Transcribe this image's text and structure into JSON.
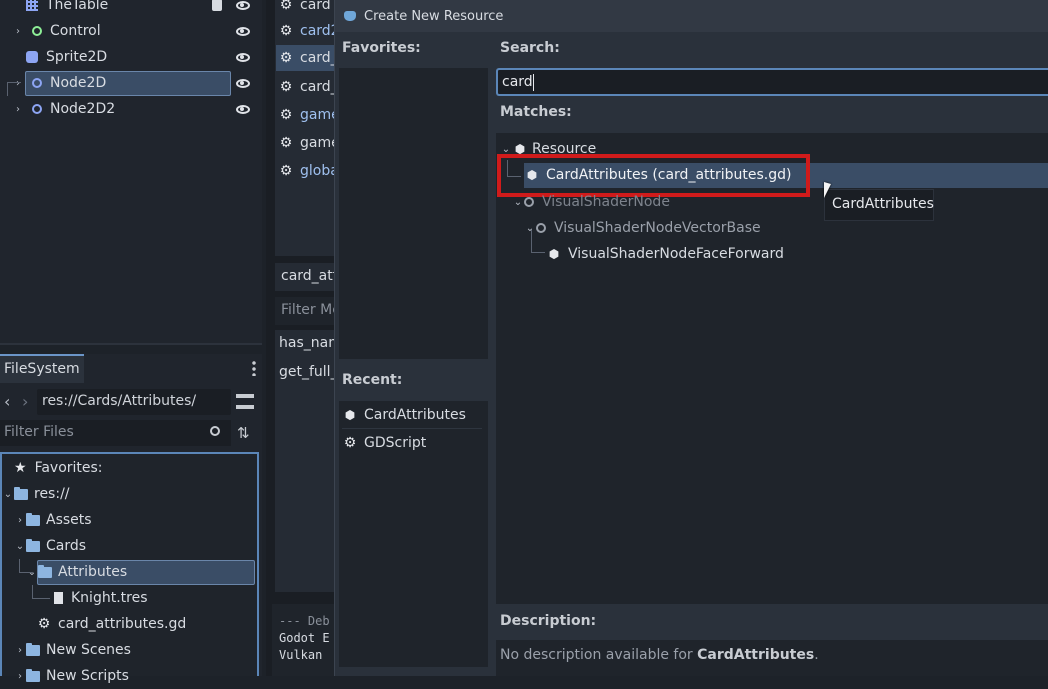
{
  "scene_tree": {
    "items": [
      {
        "label": "TheTable"
      },
      {
        "label": "Control"
      },
      {
        "label": "Sprite2D"
      },
      {
        "label": "Node2D"
      },
      {
        "label": "Node2D2"
      }
    ]
  },
  "filesystem": {
    "tab_label": "FileSystem",
    "path": "res://Cards/Attributes/",
    "filter_placeholder": "Filter Files",
    "favorites_label": "Favorites:",
    "items": [
      {
        "label": "res://"
      },
      {
        "label": "Assets"
      },
      {
        "label": "Cards"
      },
      {
        "label": "Attributes"
      },
      {
        "label": "Knight.tres"
      },
      {
        "label": "card_attributes.gd"
      },
      {
        "label": "New Scenes"
      },
      {
        "label": "New Scripts"
      }
    ]
  },
  "script_list": {
    "items": [
      "card",
      "card2",
      "card_",
      "card_",
      "game",
      "game",
      "globa"
    ],
    "current_file": "card_att",
    "filter_methods_placeholder": "Filter Me",
    "methods": [
      "has_nam",
      "get_full_"
    ],
    "output_lines": [
      "--- Deb",
      "Godot E",
      "Vulkan"
    ]
  },
  "dialog": {
    "title": "Create New Resource",
    "favorites_label": "Favorites:",
    "recent_label": "Recent:",
    "recent_items": [
      {
        "label": "CardAttributes",
        "icon": "cube-icon"
      },
      {
        "label": "GDScript",
        "icon": "gear-icon"
      }
    ],
    "search_label": "Search:",
    "search_value": "card",
    "matches_label": "Matches:",
    "matches": [
      {
        "label": "Resource"
      },
      {
        "label": "CardAttributes (card_attributes.gd)"
      },
      {
        "label": "VisualShaderNode"
      },
      {
        "label": "VisualShaderNodeVectorBase"
      },
      {
        "label": "VisualShaderNodeFaceForward"
      }
    ],
    "tooltip": "CardAttributes",
    "description_label": "Description:",
    "description_prefix": "No description available for ",
    "description_class": "CardAttributes",
    "description_suffix": "."
  },
  "colors": {
    "accent": "#4d7fb8",
    "highlight_box": "#d01b1b",
    "selected_row": "#3a5a7e"
  }
}
